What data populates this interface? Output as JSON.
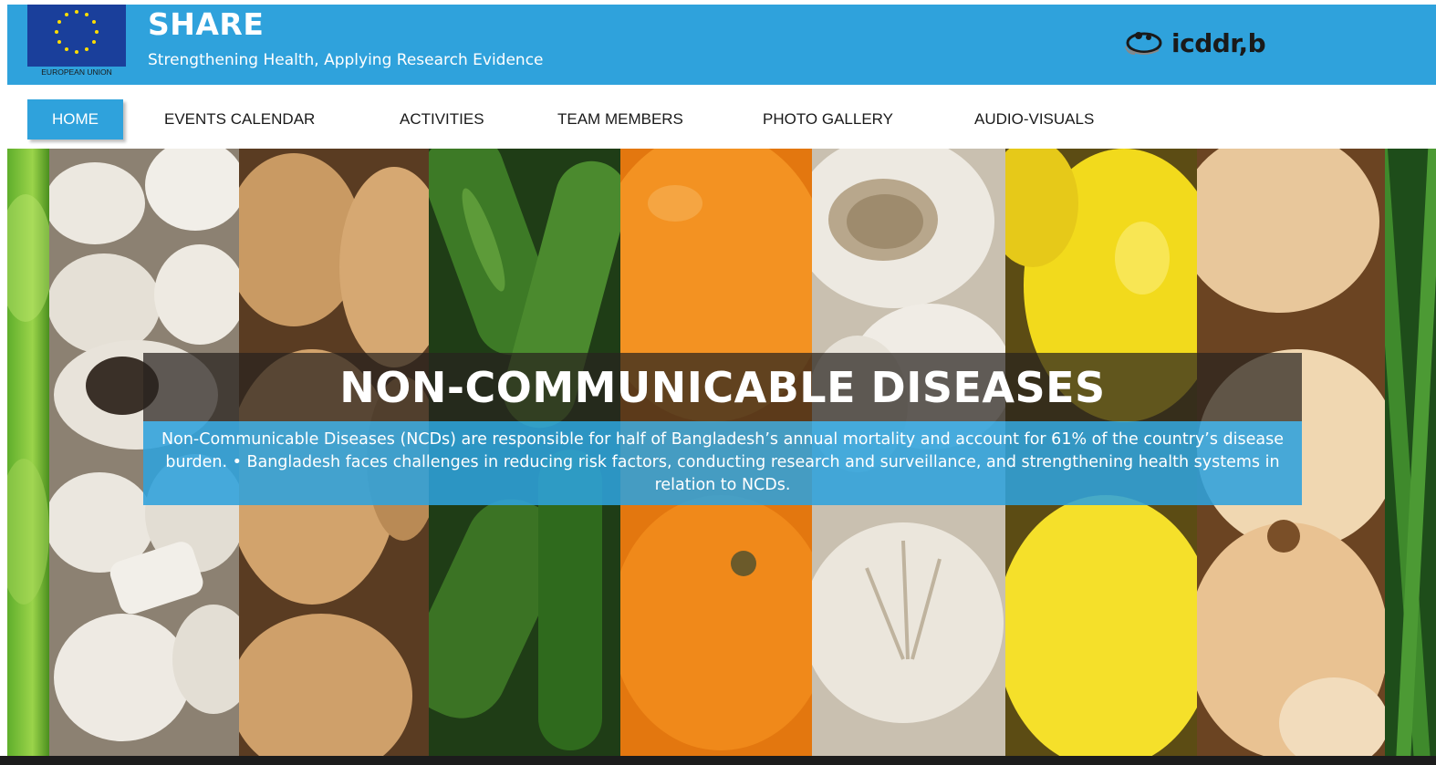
{
  "header": {
    "eu_logo_label": "EUROPEAN UNION",
    "title": "SHARE",
    "subtitle": "Strengthening Health, Applying Research Evidence",
    "partner_logo_text": "icddr,b",
    "colors": {
      "brand_blue": "#2fa2dc",
      "eu_blue": "#1a3f9b",
      "eu_gold": "#ffdd00"
    }
  },
  "nav": {
    "items": [
      {
        "label": "HOME",
        "active": true
      },
      {
        "label": "EVENTS CALENDAR",
        "active": false
      },
      {
        "label": "ACTIVITIES",
        "active": false
      },
      {
        "label": "TEAM MEMBERS",
        "active": false
      },
      {
        "label": "PHOTO GALLERY",
        "active": false
      },
      {
        "label": "AUDIO-VISUALS",
        "active": false
      }
    ]
  },
  "hero": {
    "title": "NON-COMMUNICABLE DISEASES",
    "body": "Non-Communicable Diseases (NCDs) are responsible for half of Bangladesh’s annual mortality and account for 61% of the country’s disease burden. • Bangladesh faces challenges in reducing risk factors, conducting research and surveillance, and strengthening health systems in relation to NCDs.",
    "image_strips": [
      "green-apple",
      "mushrooms",
      "potatoes",
      "cucumbers",
      "oranges",
      "garlic",
      "lemons",
      "onions",
      "green-beans"
    ]
  }
}
